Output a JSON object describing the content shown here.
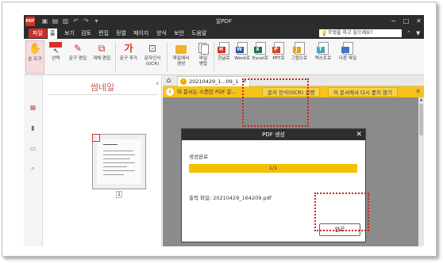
{
  "app": {
    "title": "알PDF",
    "logo": "PDF",
    "quick_access": [
      "save-icon",
      "print-icon",
      "folder-icon",
      "undo-icon",
      "redo-icon",
      "customize-icon"
    ],
    "window_controls": [
      "minimize",
      "maximize",
      "close"
    ]
  },
  "menu": {
    "items": [
      "파일",
      "홈",
      "보기",
      "검토",
      "편집",
      "정렬",
      "페이지",
      "양식",
      "보안",
      "도움말"
    ],
    "active": "홈",
    "help_placeholder": "무엇을 하고 싶으세요?"
  },
  "ribbon": {
    "buttons": [
      {
        "label": "손 도구",
        "icon": "hand-icon",
        "selected": true
      },
      {
        "label": "선택",
        "icon": "select-icon"
      },
      {
        "label": "문구 편집",
        "icon": "edit-text-icon"
      },
      {
        "label": "개체 편집",
        "icon": "edit-object-icon"
      },
      {
        "label": "문구 추가",
        "icon": "add-text-icon"
      },
      {
        "label": "문자인식\n(OCR)",
        "icon": "ocr-icon"
      },
      {
        "label": "파일에서\n생성",
        "icon": "folder-icon"
      },
      {
        "label": "파일\n병합",
        "icon": "merge-icon"
      },
      {
        "label": "한글로",
        "icon": "hwp-icon",
        "badge": "H",
        "color": "#d93025"
      },
      {
        "label": "Word로",
        "icon": "word-icon",
        "badge": "W",
        "color": "#2b579a"
      },
      {
        "label": "Excel로",
        "icon": "excel-icon",
        "badge": "X",
        "color": "#217346"
      },
      {
        "label": "PPT로",
        "icon": "ppt-icon",
        "badge": "P",
        "color": "#d24726"
      },
      {
        "label": "그림으로",
        "icon": "image-icon",
        "badge": "J",
        "color": "#e8a317"
      },
      {
        "label": "텍스트로",
        "icon": "text-icon",
        "badge": "T",
        "color": "#3fa7c4"
      },
      {
        "label": "다른 파일",
        "icon": "other-file-icon",
        "badge": "",
        "color": "#3a78c9"
      }
    ]
  },
  "thumbnail": {
    "title": "썸네일",
    "page_number": "1"
  },
  "document": {
    "tab_name": "20210429_1...09_1",
    "notice": {
      "text": "이 문서는 스캔된 PDF 문...",
      "ocr_button": "문자 인식(OCR) 실행",
      "dismiss_button": "이 문서에서 다시 묻지 않기"
    }
  },
  "dialog": {
    "title": "PDF 생성",
    "status": "생성완료",
    "progress_label": "1/1",
    "progress_fraction": 1.0,
    "output_file": "출력 파일: 20210429_164209.pdf",
    "ok_button": "완료"
  },
  "colors": {
    "accent": "#c9302c",
    "titlebar": "#2c2c2c",
    "notice": "#f7c21a",
    "progress": "#f2c200",
    "callout": "#d0201a"
  }
}
